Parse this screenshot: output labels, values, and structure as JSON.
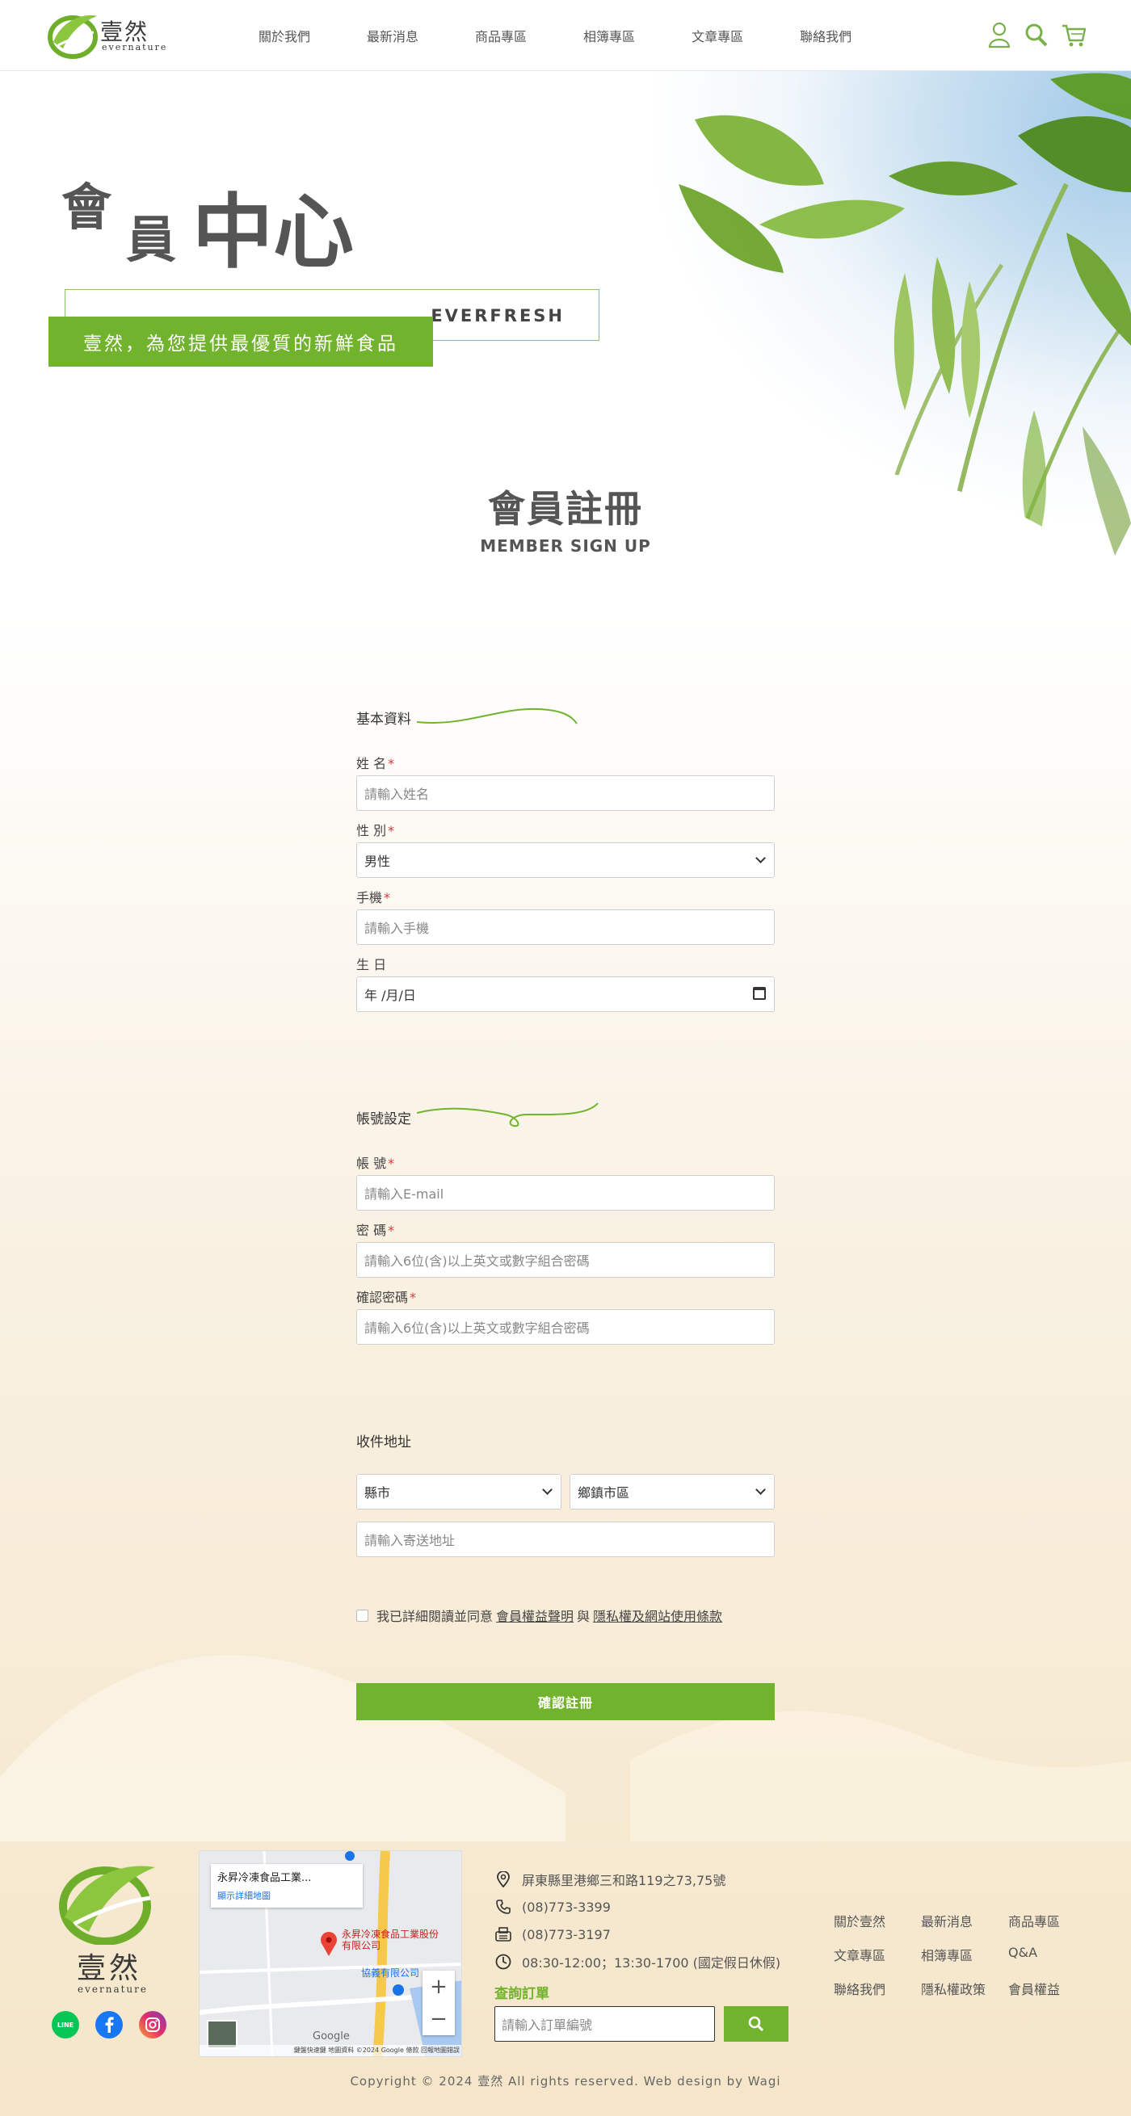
{
  "header": {
    "brand_cn": "壹然",
    "brand_en": "evernature",
    "nav": [
      "關於我們",
      "最新消息",
      "商品專區",
      "相簿專區",
      "文章專區",
      "聯絡我們"
    ]
  },
  "hero": {
    "title_c1": "會",
    "title_c2": "員",
    "title_c3": "中心",
    "tag_en": "EVERFRESH",
    "tag_cn": "壹然，為您提供最優質的新鮮食品"
  },
  "section": {
    "title_cn": "會員註冊",
    "title_en": "MEMBER SIGN UP"
  },
  "form": {
    "basic_title": "基本資料",
    "name_label": "姓 名",
    "name_placeholder": "請輸入姓名",
    "gender_label": "性 別",
    "gender_value": "男性",
    "phone_label": "手機",
    "phone_placeholder": "請輸入手機",
    "birthday_label": "生 日",
    "birthday_value": "年 /月/日",
    "account_title": "帳號設定",
    "account_label": "帳 號",
    "account_placeholder": "請輸入E-mail",
    "password_label": "密 碼",
    "password_placeholder": "請輸入6位(含)以上英文或數字組合密碼",
    "confirm_label": "確認密碼",
    "confirm_placeholder": "請輸入6位(含)以上英文或數字組合密碼",
    "address_title": "收件地址",
    "county_value": "縣市",
    "district_value": "鄉鎮市區",
    "address_placeholder": "請輸入寄送地址",
    "required_mark": "*",
    "agree_text": "我已詳細閱讀並同意",
    "agree_link1": "會員權益聲明",
    "agree_and": "與",
    "agree_link2": "隱私權及網站使用條款",
    "submit_label": "確認註冊"
  },
  "footer": {
    "brand_cn": "壹然",
    "brand_en": "evernature",
    "social": [
      "LINE",
      "facebook-icon",
      "instagram-icon"
    ],
    "map": {
      "place_title": "永昇冷凍食品工業...",
      "place_link": "顯示詳細地圖",
      "pin_label": "永昇冷凍食品工業股份有限公司",
      "nearby_label": "協義有限公司",
      "google": "Google",
      "attribution": "鍵盤快速鍵  地圖資料 ©2024 Google  條款  回報地圖錯誤"
    },
    "address": "屏東縣里港鄉三和路119之73,75號",
    "phone": "(08)773-3399",
    "fax": "(08)773-3197",
    "hours": "08:30-12:00；13:30-1700 (國定假日休假)",
    "order_title": "查詢訂單",
    "order_placeholder": "請輸入訂單編號",
    "links": [
      "關於壹然",
      "最新消息",
      "商品專區",
      "文章專區",
      "相簿專區",
      "Q&A",
      "聯絡我們",
      "隱私權政策",
      "會員權益"
    ],
    "copyright": "Copyright © 2024 壹然 All rights reserved. Web design by Wagi"
  },
  "colors": {
    "accent_green": "#72b32e",
    "required_red": "#d9373a",
    "title_gray": "#555555"
  }
}
